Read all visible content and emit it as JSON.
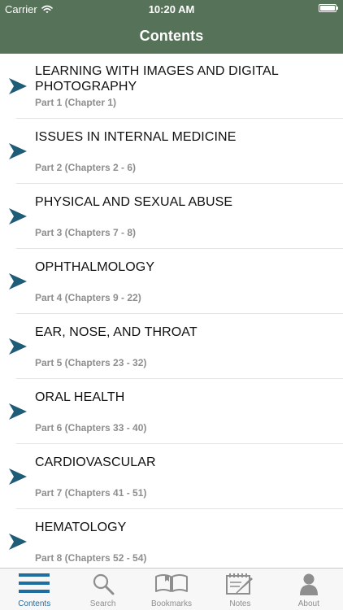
{
  "status_bar": {
    "carrier": "Carrier",
    "time": "10:20 AM"
  },
  "nav": {
    "title": "Contents"
  },
  "colors": {
    "bar": "#567258",
    "chevron": "#1f5c78",
    "active_tab": "#1f6ea0"
  },
  "items": [
    {
      "title": "LEARNING WITH IMAGES AND DIGITAL PHOTOGRAPHY",
      "subtitle": "Part 1 (Chapter 1)"
    },
    {
      "title": "ISSUES IN INTERNAL MEDICINE",
      "subtitle": "Part 2 (Chapters 2 - 6)"
    },
    {
      "title": "PHYSICAL AND SEXUAL ABUSE",
      "subtitle": "Part 3 (Chapters 7 - 8)"
    },
    {
      "title": "OPHTHALMOLOGY",
      "subtitle": "Part 4 (Chapters 9 - 22)"
    },
    {
      "title": "EAR, NOSE, AND THROAT",
      "subtitle": "Part 5 (Chapters 23 - 32)"
    },
    {
      "title": "ORAL HEALTH",
      "subtitle": "Part 6 (Chapters 33 - 40)"
    },
    {
      "title": "CARDIOVASCULAR",
      "subtitle": "Part 7 (Chapters 41 - 51)"
    },
    {
      "title": "HEMATOLOGY",
      "subtitle": "Part 8 (Chapters 52 - 54)"
    }
  ],
  "tabs": [
    {
      "label": "Contents",
      "icon": "list-icon",
      "active": true
    },
    {
      "label": "Search",
      "icon": "search-icon",
      "active": false
    },
    {
      "label": "Bookmarks",
      "icon": "book-icon",
      "active": false
    },
    {
      "label": "Notes",
      "icon": "notes-icon",
      "active": false
    },
    {
      "label": "About",
      "icon": "person-icon",
      "active": false
    }
  ]
}
